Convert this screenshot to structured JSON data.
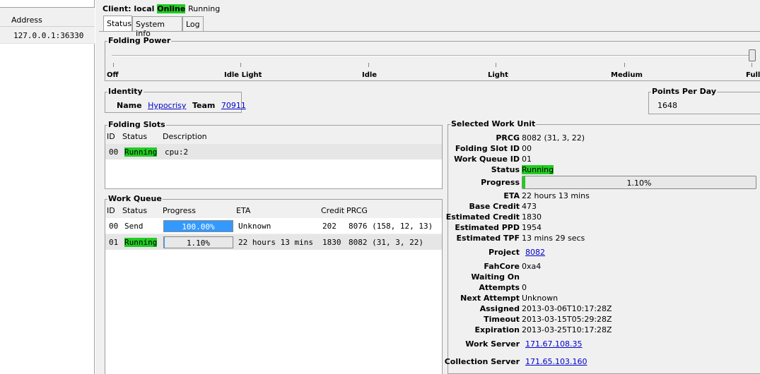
{
  "left_pane": {
    "column_header": "Address",
    "rows": [
      "127.0.0.1:36330"
    ]
  },
  "header": {
    "client_prefix": "Client: local",
    "online": "Online",
    "running": "Running"
  },
  "tabs": [
    {
      "label": "Status"
    },
    {
      "label": "System Info"
    },
    {
      "label": "Log"
    }
  ],
  "folding_power": {
    "title": "Folding Power",
    "level": 1.0,
    "ticks": [
      "Off",
      "Idle Light",
      "Idle",
      "Light",
      "Medium",
      "Full"
    ]
  },
  "identity": {
    "title": "Identity",
    "name_label": "Name",
    "name": "Hypocrisy",
    "team_label": "Team",
    "team": "70911"
  },
  "ppd": {
    "title": "Points Per Day",
    "value": "1648"
  },
  "folding_slots": {
    "title": "Folding Slots",
    "headers": [
      "ID",
      "Status",
      "Description"
    ],
    "rows": [
      {
        "id": "00",
        "status": "Running",
        "description": "cpu:2"
      }
    ]
  },
  "work_queue": {
    "title": "Work Queue",
    "headers": [
      "ID",
      "Status",
      "Progress",
      "ETA",
      "Credit",
      "PRCG"
    ],
    "rows": [
      {
        "id": "00",
        "status": "Send",
        "progress": "100.00%",
        "progress_value": 1.0,
        "eta": "Unknown",
        "credit": "202",
        "prcg": "8076 (158, 12, 13)"
      },
      {
        "id": "01",
        "status": "Running",
        "progress": "1.10%",
        "progress_value": 0.011,
        "eta": "22 hours 13 mins",
        "credit": "1830",
        "prcg": "8082 (31, 3, 22)"
      }
    ]
  },
  "selected_work_unit": {
    "title": "Selected Work Unit",
    "prcg_label": "PRCG",
    "prcg": "8082 (31, 3, 22)",
    "slot_label": "Folding Slot ID",
    "slot": "00",
    "queue_label": "Work Queue ID",
    "queue": "01",
    "status_label": "Status",
    "status": "Running",
    "progress_label": "Progress",
    "progress": "1.10%",
    "progress_value": 0.011,
    "eta_label": "ETA",
    "eta": "22 hours 13 mins",
    "base_credit_label": "Base Credit",
    "base_credit": "473",
    "est_credit_label": "Estimated Credit",
    "est_credit": "1830",
    "est_ppd_label": "Estimated PPD",
    "est_ppd": "1954",
    "est_tpf_label": "Estimated TPF",
    "est_tpf": "13 mins 29 secs",
    "project_label": "Project",
    "project": "8082",
    "fahcore_label": "FahCore",
    "fahcore": "0xa4",
    "waiting_label": "Waiting On",
    "waiting": "",
    "attempts_label": "Attempts",
    "attempts": "0",
    "next_attempt_label": "Next Attempt",
    "next_attempt": "Unknown",
    "assigned_label": "Assigned",
    "assigned": "2013-03-06T10:17:28Z",
    "timeout_label": "Timeout",
    "timeout": "2013-03-15T05:29:28Z",
    "expiration_label": "Expiration",
    "expiration": "2013-03-25T10:17:28Z",
    "work_server_label": "Work Server",
    "work_server": "171.67.108.35",
    "collection_server_label": "Collection Server",
    "collection_server": "171.65.103.160"
  },
  "colors": {
    "running": "#22cc22",
    "progress_fill": "#3399ff",
    "link": "#0000cc"
  }
}
